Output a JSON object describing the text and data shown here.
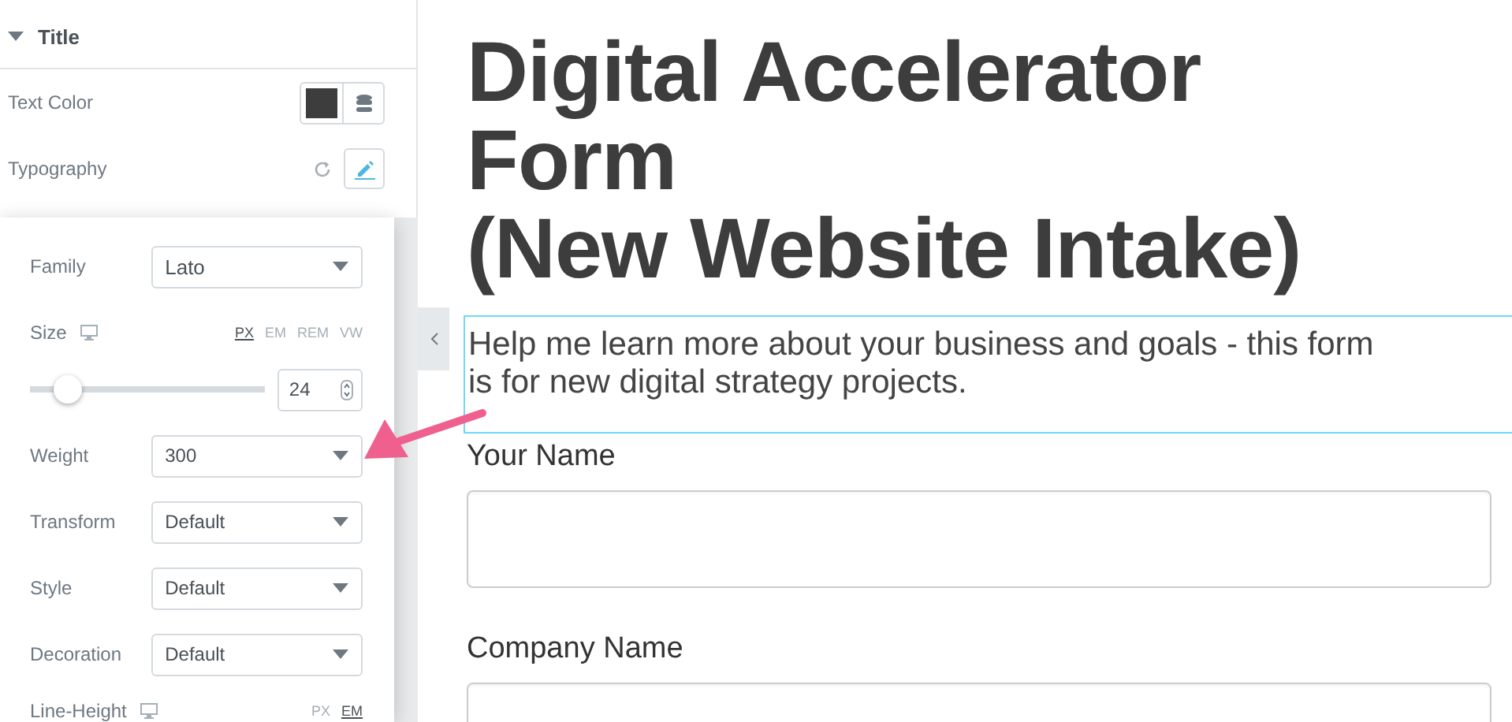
{
  "panel": {
    "section": {
      "title": "Title",
      "expanded": true
    },
    "text_color": {
      "label": "Text Color",
      "color": "#3d3d3d"
    },
    "typography": {
      "label": "Typography",
      "editing": true
    },
    "popover": {
      "family": {
        "label": "Family",
        "value": "Lato"
      },
      "size": {
        "label": "Size",
        "units": [
          {
            "label": "PX",
            "selected": true
          },
          {
            "label": "EM",
            "selected": false
          },
          {
            "label": "REM",
            "selected": false
          },
          {
            "label": "VW",
            "selected": false
          }
        ],
        "level": 0.11,
        "value": "24"
      },
      "selects": [
        {
          "label": "Weight",
          "value": "300"
        },
        {
          "label": "Transform",
          "value": "Default"
        },
        {
          "label": "Style",
          "value": "Default"
        },
        {
          "label": "Decoration",
          "value": "Default"
        }
      ],
      "line_height": {
        "label": "Line-Height",
        "units": [
          {
            "label": "PX",
            "selected": false
          },
          {
            "label": "EM",
            "selected": true
          }
        ]
      }
    }
  },
  "canvas": {
    "heading": "Digital Accelerator Form\n(New Website Intake)",
    "description": "Help me learn more about your business and goals - this form is for new digital strategy projects.",
    "fields": [
      {
        "label": "Your Name"
      },
      {
        "label": "Company Name"
      }
    ]
  }
}
